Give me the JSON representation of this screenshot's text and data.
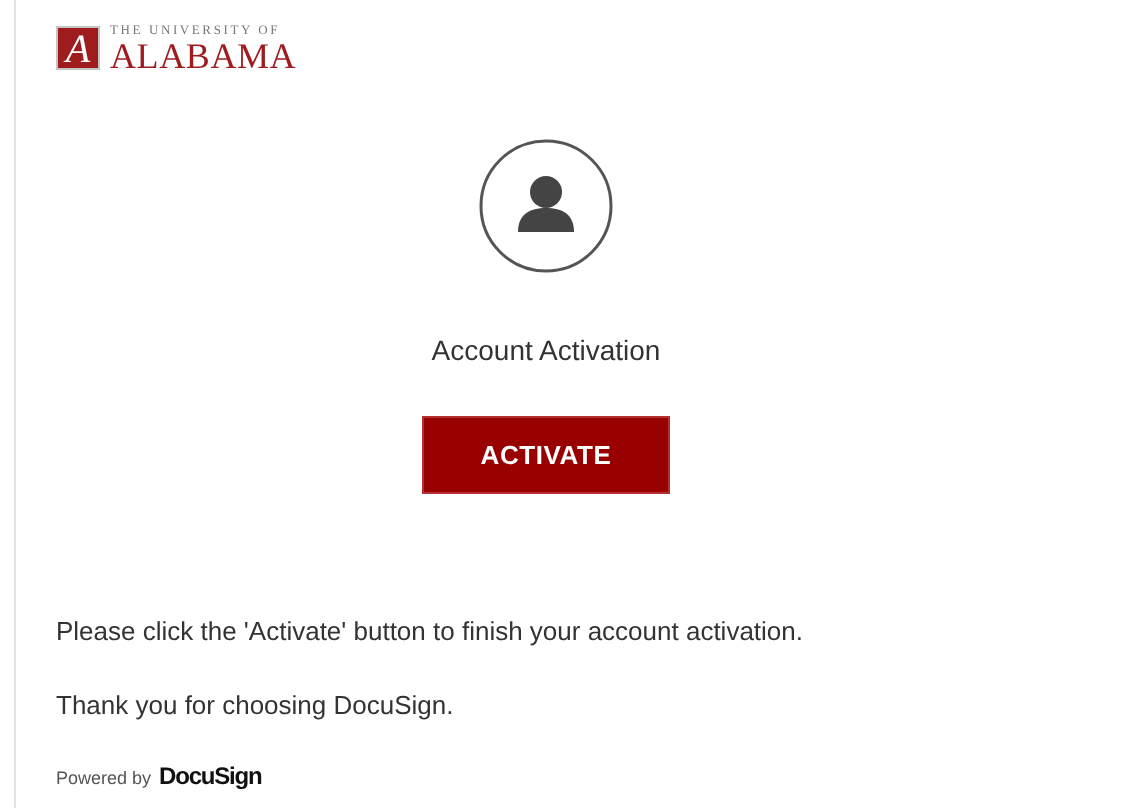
{
  "logo": {
    "mark": "A",
    "line1": "THE UNIVERSITY OF",
    "line2": "ALABAMA"
  },
  "title": "Account Activation",
  "button": "ACTIVATE",
  "message": "Please click the 'Activate' button to finish your account activation.",
  "thanks": "Thank you for choosing DocuSign.",
  "footer": {
    "prefix": "Powered by",
    "brand": "DocuSign"
  }
}
